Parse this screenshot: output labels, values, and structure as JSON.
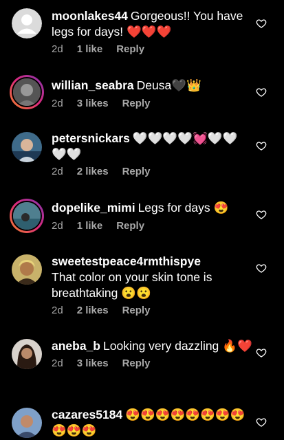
{
  "comments": [
    {
      "username": "moonlakes44",
      "text": "Gorgeous!! You have legs for days! ❤️❤️❤️",
      "time": "2d",
      "likes": "1 like",
      "reply": "Reply",
      "avatar": "default-avatar-icon"
    },
    {
      "username": "willian_seabra",
      "text": "Deusa🖤👑",
      "time": "2d",
      "likes": "3 likes",
      "reply": "Reply",
      "avatar": "profile-photo"
    },
    {
      "username": "petersnickars",
      "text": "🤍🤍🤍🤍💓🤍🤍🤍🤍",
      "time": "2d",
      "likes": "2 likes",
      "reply": "Reply",
      "avatar": "profile-photo"
    },
    {
      "username": "dopelike_mimi",
      "text": "Legs for days 😍",
      "time": "2d",
      "likes": "1 like",
      "reply": "Reply",
      "avatar": "profile-photo"
    },
    {
      "username": "sweetestpeace4rmthispye",
      "text": "That color on your skin tone is breathtaking 😮😮",
      "time": "2d",
      "likes": "2 likes",
      "reply": "Reply",
      "avatar": "profile-photo"
    },
    {
      "username": "aneba_b",
      "text": "Looking very dazzling 🔥❤️",
      "time": "2d",
      "likes": "3 likes",
      "reply": "Reply",
      "avatar": "profile-photo"
    },
    {
      "username": "cazares5184",
      "text": "😍😍😍😍😍😍😍😍😍😍😍",
      "time": "",
      "likes": "",
      "reply": "",
      "avatar": "profile-photo"
    }
  ],
  "colors": {
    "background": "#000000",
    "text": "#ffffff",
    "meta": "#a8a8a8",
    "story_ring_start": "#f58529",
    "story_ring_end": "#8134af"
  },
  "icons": {
    "like": "heart-outline-icon"
  }
}
